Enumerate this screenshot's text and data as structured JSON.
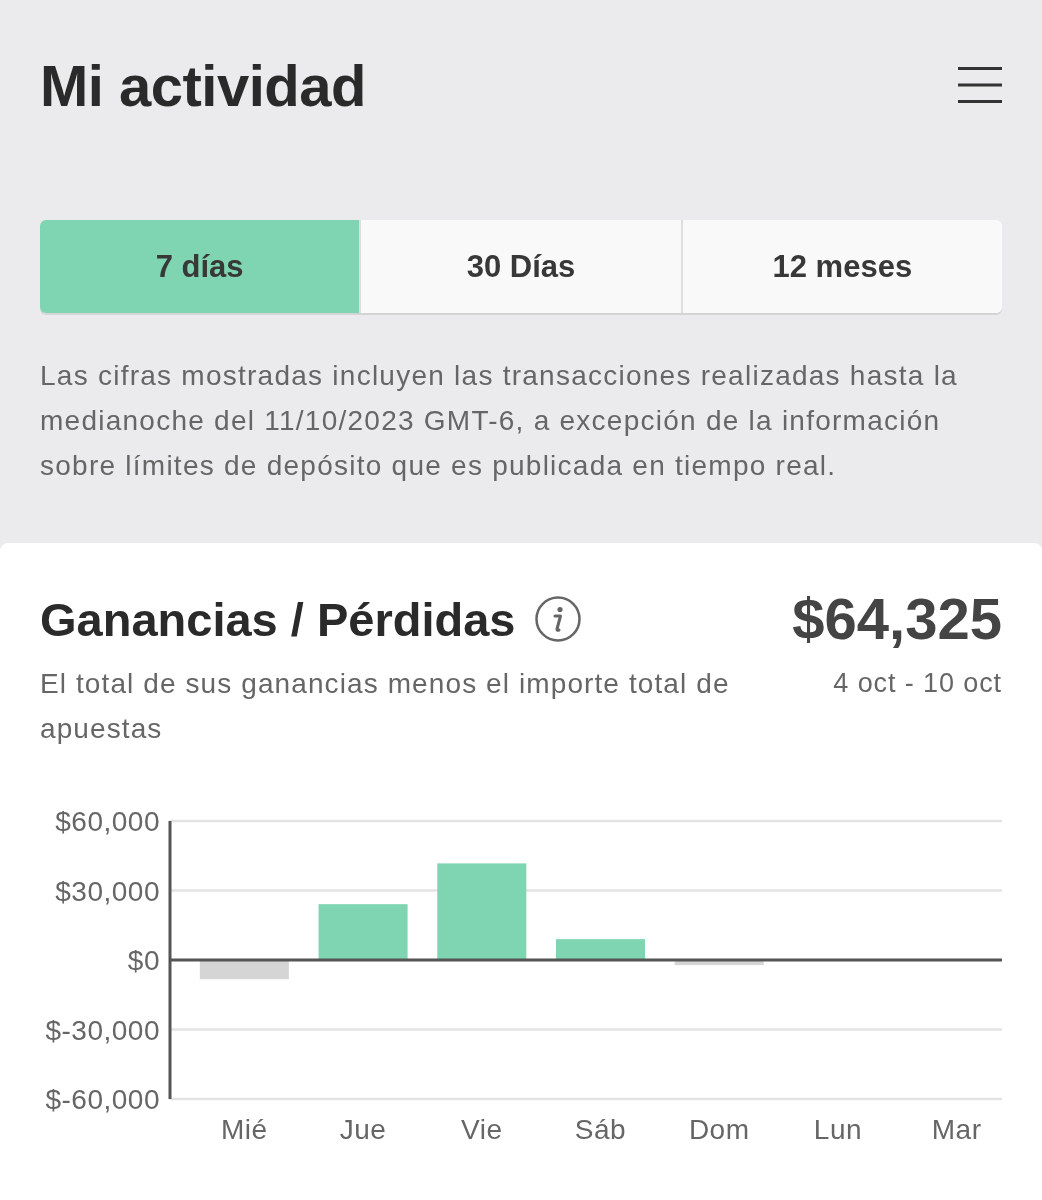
{
  "header": {
    "title": "Mi actividad"
  },
  "tabs": [
    {
      "label": "7 días",
      "selected": true
    },
    {
      "label": "30 Días",
      "selected": false
    },
    {
      "label": "12 meses",
      "selected": false
    }
  ],
  "notice": "Las cifras mostradas incluyen las transacciones realizadas hasta la medianoche del 11/10/2023 GMT-6, a excepción de la información sobre límites de depósito que es publicada en tiempo real.",
  "summary": {
    "title": "Ganancias / Pérdidas",
    "amount": "$64,325",
    "description": "El total de sus ganancias menos el importe total de apuestas",
    "date_range": "4 oct - 10 oct",
    "chart_data": {
      "type": "bar",
      "stacked": true,
      "categories": [
        "Mié",
        "Jue",
        "Vie",
        "Sáb",
        "Dom",
        "Lun",
        "Mar"
      ],
      "series": [
        {
          "color": "#7fd5b1",
          "values": [
            null,
            24100,
            41700,
            9000,
            null,
            0,
            0
          ]
        },
        {
          "color": "#d5d5d5",
          "values": [
            -8300,
            null,
            null,
            null,
            -2200,
            null,
            null
          ]
        }
      ],
      "ylim": [
        -60000,
        60000
      ],
      "yticks": [
        {
          "value": 60000,
          "label": "$60,000"
        },
        {
          "value": 30000,
          "label": "$30,000"
        },
        {
          "value": 0,
          "label": "$0"
        },
        {
          "value": -30000,
          "label": "$-30,000"
        },
        {
          "value": -60000,
          "label": "$-60,000"
        }
      ]
    }
  }
}
